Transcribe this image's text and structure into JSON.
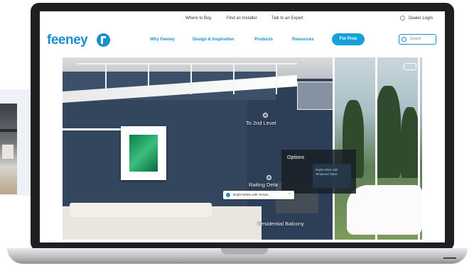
{
  "site": {
    "topbar": {
      "links": [
        "Where to Buy",
        "Find an Installer",
        "Talk to an Expert"
      ],
      "dealer_login": "Dealer Login"
    },
    "logo_text": "feeney",
    "nav": {
      "links": [
        "Why Feeney",
        "Design & Inspiration",
        "Products",
        "Resources"
      ],
      "pro_button": "For Pros",
      "search_placeholder": "Search"
    }
  },
  "tour": {
    "hotspots": {
      "upper_level": "To 2nd Level",
      "railing_detail": "Railing Deta",
      "balcony": "Residential Balcony"
    },
    "options_panel": {
      "title": "Options",
      "selected_option": "Bright White with Tempered Glass"
    },
    "selection_bar": {
      "text": "Bright White with Tempe...",
      "close_label": "×"
    }
  },
  "colors": {
    "brand_blue": "#1a8fc9",
    "wall_navy": "#33455c"
  }
}
